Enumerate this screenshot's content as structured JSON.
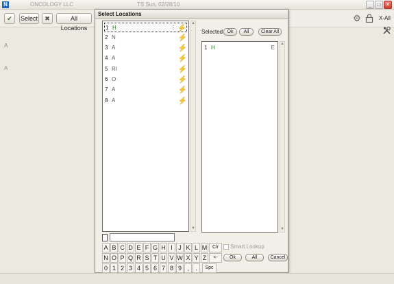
{
  "app": {
    "logo": "N",
    "title": "ONCOLOGY LLC",
    "subtitle": "TS Sun, 02/28/10"
  },
  "window_buttons": [
    "_",
    "□",
    "✕"
  ],
  "toolbar": {
    "check_icon": "✔",
    "select_label": "Select",
    "clear_icon": "✖",
    "all_locations_label": "All Locations",
    "xall_label": "X-All"
  },
  "side_letters": [
    "A",
    "A"
  ],
  "dialog": {
    "title": "Select Locations",
    "locations": [
      {
        "num": "1",
        "label": "H",
        "dots": "⋮"
      },
      {
        "num": "2",
        "label": "N"
      },
      {
        "num": "3",
        "label": "A"
      },
      {
        "num": "4",
        "label": "A"
      },
      {
        "num": "5",
        "label": "RI"
      },
      {
        "num": "6",
        "label": "O"
      },
      {
        "num": "7",
        "label": "A"
      },
      {
        "num": "8",
        "label": "A"
      }
    ],
    "selected_label": "Selected",
    "ok_label": "Ok",
    "all_label": "All",
    "clear_all_label": "Clear All",
    "selected_items": [
      {
        "num": "1",
        "label": "H",
        "right": "E"
      }
    ],
    "keys_row1": [
      "A",
      "B",
      "C",
      "D",
      "E",
      "F",
      "G",
      "H",
      "I",
      "J",
      "K",
      "L",
      "M",
      "Clr"
    ],
    "keys_row2": [
      "N",
      "O",
      "P",
      "Q",
      "R",
      "S",
      "T",
      "U",
      "V",
      "W",
      "X",
      "Y",
      "Z",
      "<-"
    ],
    "keys_row3": [
      "0",
      "1",
      "2",
      "3",
      "4",
      "5",
      "6",
      "7",
      "8",
      "9",
      ",",
      ".",
      "Spc"
    ],
    "smart_lookup_label": "Smart Lookup",
    "bottom_ok_label": "Ok",
    "bottom_all_label": "All",
    "cancel_label": "Cancel"
  }
}
